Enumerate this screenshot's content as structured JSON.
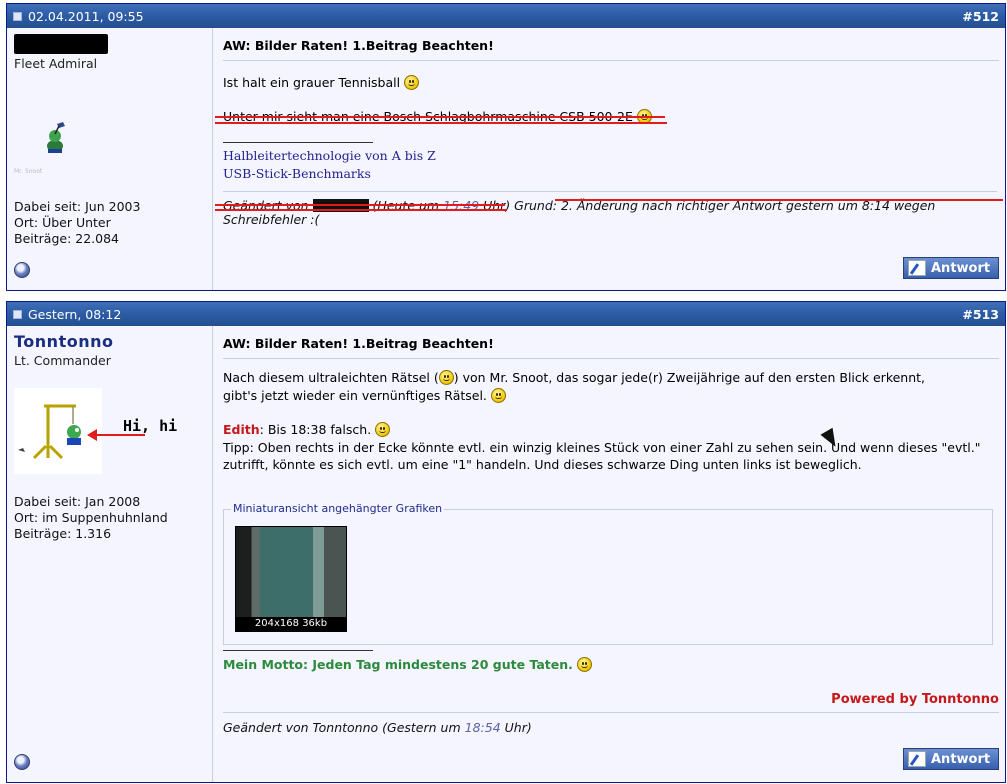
{
  "post1": {
    "date": "02.04.2011, 09:55",
    "number": "#512",
    "author_title": "Fleet Admiral",
    "avatar_caption": "Mr. Snoot",
    "stats": [
      "Dabei seit: Jun 2003",
      "Ort: Über Unter",
      "Beiträge: 22.084"
    ],
    "title": "AW: Bilder Raten! 1.Beitrag Beachten!",
    "line1": "Ist halt ein grauer Tennisball",
    "line2": "Unter mir sieht man eine Bosch Schlagbohrmaschine CSB 500-2E",
    "sig_links": [
      "Halbleitertechnologie von A bis Z",
      "USB-Stick-Benchmarks"
    ],
    "edit_prefix": "Geändert von",
    "edit_open": "(Heute um",
    "edit_time": "15:49",
    "edit_close": "Uhr) Grund:",
    "edit_reason": "2. Änderung nach richtiger Antwort gestern um 8:14 wegen Schreibfehler :(",
    "reply_label": "Antwort"
  },
  "post2": {
    "date": "Gestern, 08:12",
    "number": "#513",
    "author": "Tonntonno",
    "author_title": "Lt. Commander",
    "avatar_text": "Hi, hi",
    "stats": [
      "Dabei seit: Jan 2008",
      "Ort: im Suppenhuhnland",
      "Beiträge: 1.316"
    ],
    "title": "AW: Bilder Raten! 1.Beitrag Beachten!",
    "para1a": "Nach diesem ultraleichten Rätsel (",
    "para1b": ") von Mr. Snoot, das sogar jede(r) Zweijährige auf den ersten Blick erkennt,",
    "para1c": "gibt's jetzt wieder ein vernünftiges Rätsel.",
    "edith_label": "Edith",
    "edith_text": ": Bis 18:38 falsch.",
    "tip": "Tipp: Oben rechts in der Ecke könnte evtl. ein winzig kleines Stück von einer Zahl zu sehen sein. Und wenn dieses \"evtl.\" zutrifft, könnte es sich evtl. um eine \"1\" handeln. Und dieses schwarze Ding unten links ist beweglich.",
    "attach_legend": "Miniaturansicht angehängter Grafiken",
    "thumb_caption": "204x168  36kb",
    "motto": "Mein Motto: Jeden Tag mindestens 20 gute Taten.",
    "powered": "Powered by Tonntonno",
    "edit_prefix": "Geändert von Tonntonno (Gestern um",
    "edit_time": "18:54",
    "edit_close": "Uhr)",
    "reply_label": "Antwort"
  },
  "colors": {
    "header_blue": "#2b5aa3",
    "username_blue": "#1a2e80",
    "annotation_red": "#e01c1c",
    "motto_green": "#2b8a3c",
    "powered_red": "#c51818"
  }
}
